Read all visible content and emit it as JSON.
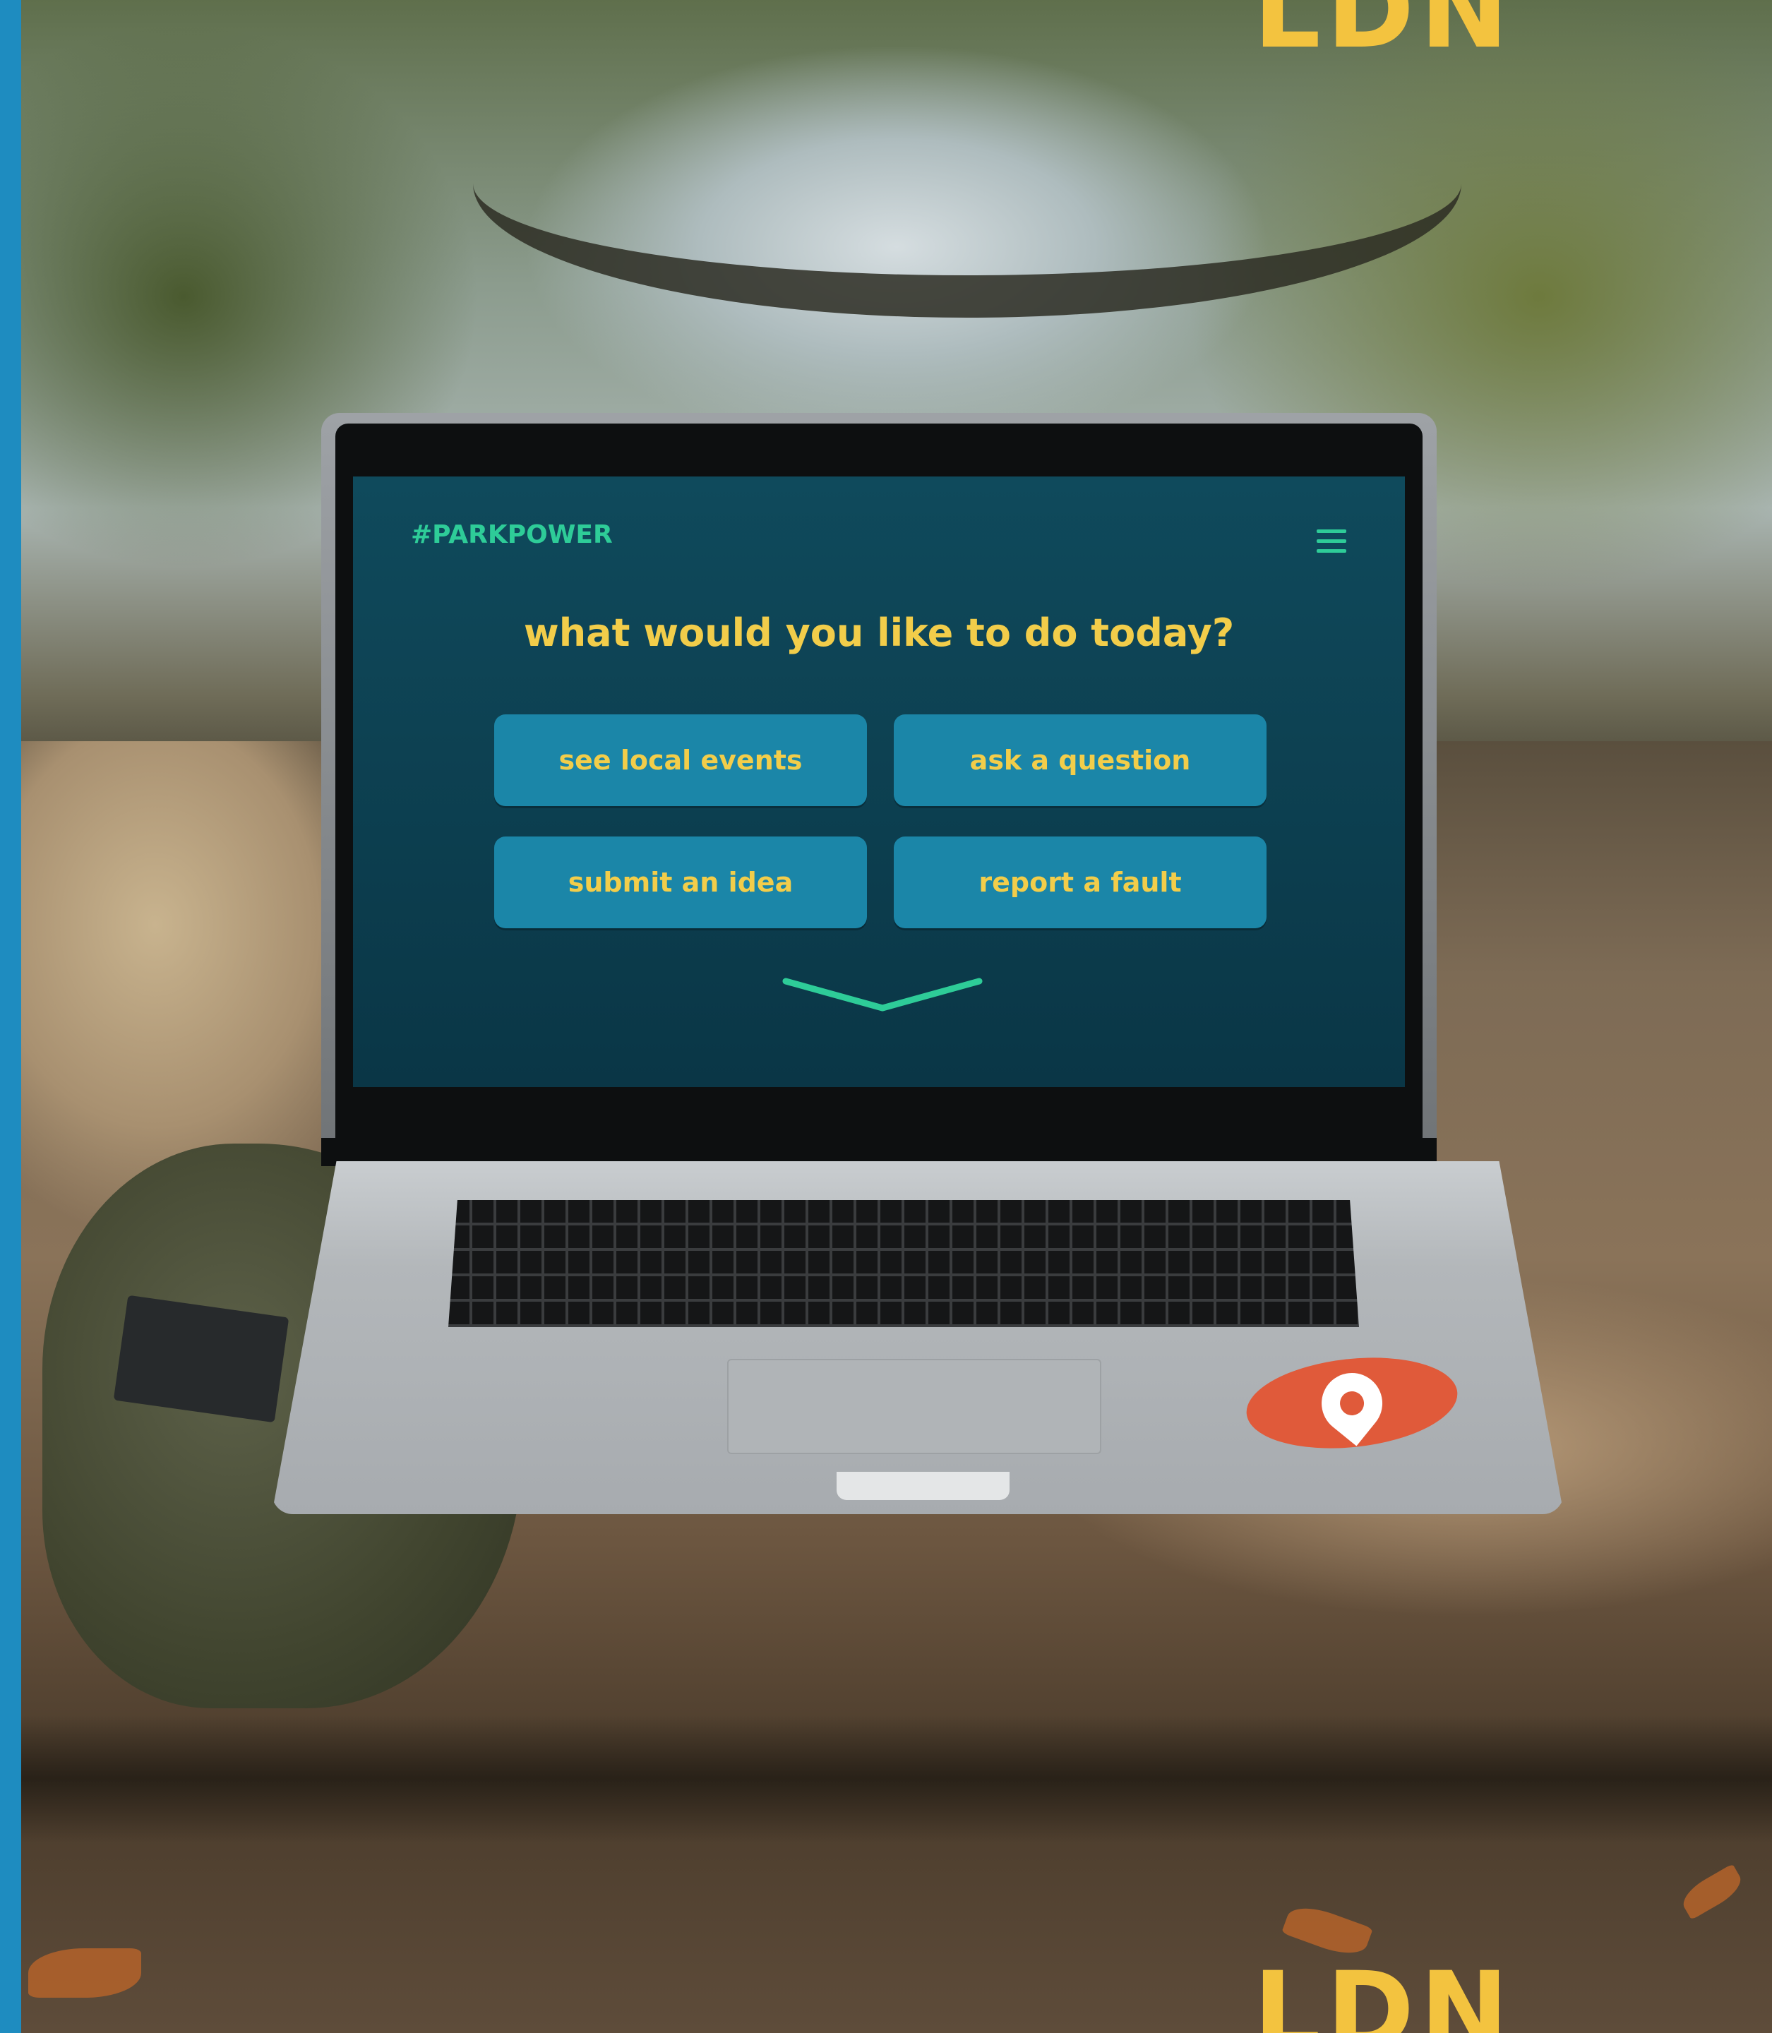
{
  "app": {
    "brand": "#PARKPOWER",
    "headline": "what would you like to do today?",
    "actions": [
      {
        "label": "see local events"
      },
      {
        "label": "ask a question"
      },
      {
        "label": "submit an idea"
      },
      {
        "label": "report a fault"
      }
    ],
    "menu_icon": "hamburger-menu-icon",
    "scroll_icon": "chevron-down-icon"
  },
  "overlay": {
    "logo_top": "LDN",
    "logo_bottom": "LDN"
  },
  "colors": {
    "accent_green": "#2ecc98",
    "headline_yellow": "#f2cd4a",
    "button_blue": "#1b86a8",
    "screen_bg": "#0d4152",
    "side_bar": "#1e8cc0",
    "logo_yellow": "#f3c33f",
    "sticker_red": "#e05a3a"
  }
}
